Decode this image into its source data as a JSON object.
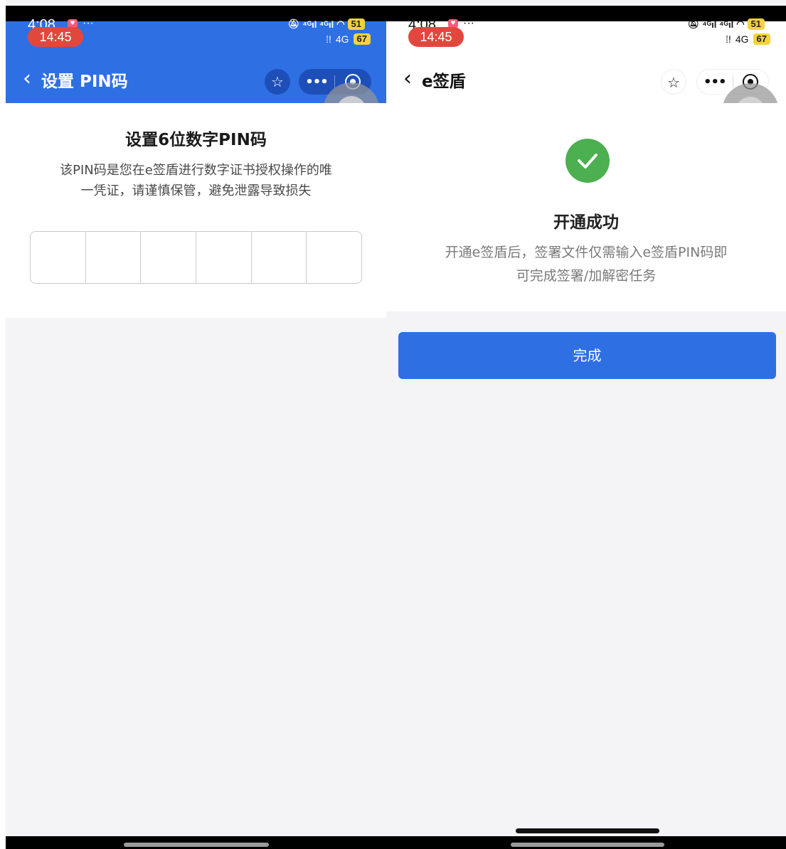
{
  "colors": {
    "accent": "#2f6fe4",
    "success": "#4caf50",
    "background": "#f4f4f7"
  },
  "left": {
    "status": {
      "time_old": "4:08",
      "time_pill": "14:45",
      "signal_text": "⁴ᴳıl ⁴ᴳıl",
      "network": "4G",
      "battery_top": "51",
      "battery_bottom": "67"
    },
    "nav": {
      "title": "设置 PIN码"
    },
    "content": {
      "title": "设置6位数字PIN码",
      "description": "该PIN码是您在e签盾进行数字证书授权操作的唯一凭证，请谨慎保管，避免泄露导致损失"
    }
  },
  "right": {
    "status": {
      "time_old": "4:08",
      "time_pill": "14:45",
      "signal_text": "⁴ᴳıl ⁴ᴳıl",
      "network": "4G",
      "battery_top": "51",
      "battery_bottom": "67"
    },
    "nav": {
      "title": "e签盾"
    },
    "content": {
      "success_title": "开通成功",
      "success_desc": "开通e签盾后，签署文件仅需输入e签盾PIN码即可完成签署/加解密任务",
      "done_label": "完成"
    }
  }
}
